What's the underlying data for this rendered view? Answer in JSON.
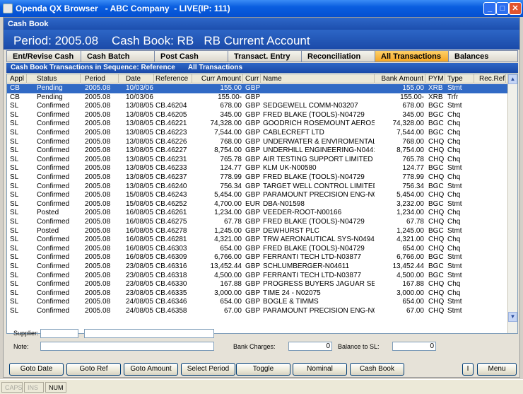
{
  "window": {
    "title": "Openda QX Browser   - ABC Company  - LIVE(IP: 111)"
  },
  "panel_title": "Cash Book",
  "header": {
    "period": "Period: 2005.08",
    "book": "Cash Book: RB",
    "account": "RB Current Account"
  },
  "tabs": [
    {
      "label": "Ent/Revise Cash"
    },
    {
      "label": "Cash Batch"
    },
    {
      "label": "Post Cash"
    },
    {
      "label": "Transact. Entry"
    },
    {
      "label": "Reconciliation"
    },
    {
      "label": "All Transactions",
      "active": true
    },
    {
      "label": "Balances"
    }
  ],
  "subheader": {
    "title": "Cash Book Transactions in Sequence: Reference",
    "filter": "All Transactions"
  },
  "columns": [
    "Appl",
    "Status",
    "Period",
    "Date",
    "Reference",
    "Curr Amount",
    "Curr",
    "Name",
    "Bank Amount",
    "PYM",
    "Type",
    "Rec.Ref."
  ],
  "rows": [
    [
      "CB",
      "Pending",
      "2005.08",
      "10/03/06",
      "",
      "155.00",
      "GBP",
      "",
      "155.00",
      "XRB",
      "Stmt",
      ""
    ],
    [
      "CB",
      "Pending",
      "2005.08",
      "10/03/06",
      "",
      "155.00-",
      "GBP",
      "",
      "155.00-",
      "XRB",
      "Trfr",
      ""
    ],
    [
      "SL",
      "Confirmed",
      "2005.08",
      "13/08/05",
      "CB.46204",
      "678.00",
      "GBP",
      "SEDGEWELL COMM-N03207",
      "678.00",
      "BGC",
      "Stmt",
      ""
    ],
    [
      "SL",
      "Confirmed",
      "2005.08",
      "13/08/05",
      "CB.46205",
      "345.00",
      "GBP",
      "FRED BLAKE (TOOLS)-N04729",
      "345.00",
      "BGC",
      "Chq",
      ""
    ],
    [
      "SL",
      "Confirmed",
      "2005.08",
      "13/08/05",
      "CB.46221",
      "74,328.00",
      "GBP",
      "GOODRICH ROSEMOUNT AEROSP",
      "74,328.00",
      "BGC",
      "Chq",
      ""
    ],
    [
      "SL",
      "Confirmed",
      "2005.08",
      "13/08/05",
      "CB.46223",
      "7,544.00",
      "GBP",
      "CABLECREFT LTD",
      "7,544.00",
      "BGC",
      "Chq",
      ""
    ],
    [
      "SL",
      "Confirmed",
      "2005.08",
      "13/08/05",
      "CB.46226",
      "768.00",
      "GBP",
      "UNDERWATER & ENVIROMENTAL '",
      "768.00",
      "CHQ",
      "Chq",
      ""
    ],
    [
      "SL",
      "Confirmed",
      "2005.08",
      "13/08/05",
      "CB.46227",
      "8,754.00",
      "GBP",
      "UNDERHILL ENGINEERING-N0441",
      "8,754.00",
      "CHQ",
      "Chq",
      ""
    ],
    [
      "SL",
      "Confirmed",
      "2005.08",
      "13/08/05",
      "CB.46231",
      "765.78",
      "GBP",
      "AIR TESTING SUPPORT LIMITED",
      "765.78",
      "CHQ",
      "Chq",
      ""
    ],
    [
      "SL",
      "Confirmed",
      "2005.08",
      "13/08/05",
      "CB.46233",
      "124.77",
      "GBP",
      "KLM UK-N00580",
      "124.77",
      "BGC",
      "Stmt",
      ""
    ],
    [
      "SL",
      "Confirmed",
      "2005.08",
      "13/08/05",
      "CB.46237",
      "778.99",
      "GBP",
      "FRED BLAKE (TOOLS)-N04729",
      "778.99",
      "CHQ",
      "Chq",
      ""
    ],
    [
      "SL",
      "Confirmed",
      "2005.08",
      "13/08/05",
      "CB.46240",
      "756.34",
      "GBP",
      "TARGET WELL CONTROL LIMITED",
      "756.34",
      "BGC",
      "Stmt",
      ""
    ],
    [
      "SL",
      "Confirmed",
      "2005.08",
      "15/08/05",
      "CB.46243",
      "5,454.00",
      "GBP",
      "PARAMOUNT PRECISION ENG-N00",
      "5,454.00",
      "CHQ",
      "Chq",
      ""
    ],
    [
      "SL",
      "Confirmed",
      "2005.08",
      "15/08/05",
      "CB.46252",
      "4,700.00",
      "EUR",
      "DBA-N01598",
      "3,232.00",
      "BGC",
      "Stmt",
      ""
    ],
    [
      "SL",
      "Posted",
      "2005.08",
      "16/08/05",
      "CB.46261",
      "1,234.00",
      "GBP",
      "VEEDER-ROOT-N00166",
      "1,234.00",
      "CHQ",
      "Chq",
      ""
    ],
    [
      "SL",
      "Confirmed",
      "2005.08",
      "16/08/05",
      "CB.46275",
      "67.78",
      "GBP",
      "FRED BLAKE (TOOLS)-N04729",
      "67.78",
      "CHQ",
      "Chq",
      ""
    ],
    [
      "SL",
      "Posted",
      "2005.08",
      "16/08/05",
      "CB.46278",
      "1,245.00",
      "GBP",
      "DEWHURST PLC",
      "1,245.00",
      "BGC",
      "Stmt",
      ""
    ],
    [
      "SL",
      "Confirmed",
      "2005.08",
      "16/08/05",
      "CB.46281",
      "4,321.00",
      "GBP",
      "TRW AERONAUTICAL SYS-N04948",
      "4,321.00",
      "CHQ",
      "Chq",
      ""
    ],
    [
      "SL",
      "Confirmed",
      "2005.08",
      "16/08/05",
      "CB.46303",
      "654.00",
      "GBP",
      "FRED BLAKE (TOOLS)-N04729",
      "654.00",
      "CHQ",
      "Chq",
      ""
    ],
    [
      "SL",
      "Confirmed",
      "2005.08",
      "16/08/05",
      "CB.46309",
      "6,766.00",
      "GBP",
      "FERRANTI TECH LTD-N03877",
      "6,766.00",
      "BGC",
      "Stmt",
      ""
    ],
    [
      "SL",
      "Confirmed",
      "2005.08",
      "23/08/05",
      "CB.46316",
      "13,452.44",
      "GBP",
      "SCHLUMBERGER-N04611",
      "13,452.44",
      "BGC",
      "Stmt",
      ""
    ],
    [
      "SL",
      "Confirmed",
      "2005.08",
      "23/08/05",
      "CB.46318",
      "4,500.00",
      "GBP",
      "FERRANTI TECH LTD-N03877",
      "4,500.00",
      "BGC",
      "Stmt",
      ""
    ],
    [
      "SL",
      "Confirmed",
      "2005.08",
      "23/08/05",
      "CB.46330",
      "167.88",
      "GBP",
      "PROGRESS BUYERS JAGUAR SER",
      "167.88",
      "CHQ",
      "Chq",
      ""
    ],
    [
      "SL",
      "Confirmed",
      "2005.08",
      "23/08/05",
      "CB.46335",
      "3,000.00",
      "GBP",
      "TIME 24 - N02075",
      "3,000.00",
      "CHQ",
      "Chq",
      ""
    ],
    [
      "SL",
      "Confirmed",
      "2005.08",
      "24/08/05",
      "CB.46346",
      "654.00",
      "GBP",
      "BOGLE & TIMMS",
      "654.00",
      "CHQ",
      "Stmt",
      ""
    ],
    [
      "SL",
      "Confirmed",
      "2005.08",
      "24/08/05",
      "CB.46358",
      "67.00",
      "GBP",
      "PARAMOUNT PRECISION ENG-N00",
      "67.00",
      "CHQ",
      "Stmt",
      ""
    ]
  ],
  "form": {
    "supplier_label": "Supplier:",
    "supplier_code": "",
    "supplier_name": "",
    "note_label": "Note:",
    "note_value": "",
    "bank_charges_label": "Bank Charges:",
    "bank_charges_value": "0",
    "balance_label": "Balance to SL:",
    "balance_value": "0"
  },
  "buttons": {
    "goto_date": "Goto Date",
    "goto_ref": "Goto Ref",
    "goto_amount": "Goto Amount",
    "select_period": "Select Period",
    "toggle": "Toggle",
    "nominal": "Nominal",
    "cash_book": "Cash Book",
    "info": "I",
    "menu": "Menu"
  },
  "status": {
    "caps": "CAPS",
    "ins": "INS",
    "num": "NUM"
  },
  "icons": {
    "app": "app-icon",
    "minimize": "minimize-icon",
    "maximize": "maximize-icon",
    "close": "close-icon",
    "scroll_up": "scroll-up-icon",
    "scroll_down": "scroll-down-icon"
  }
}
